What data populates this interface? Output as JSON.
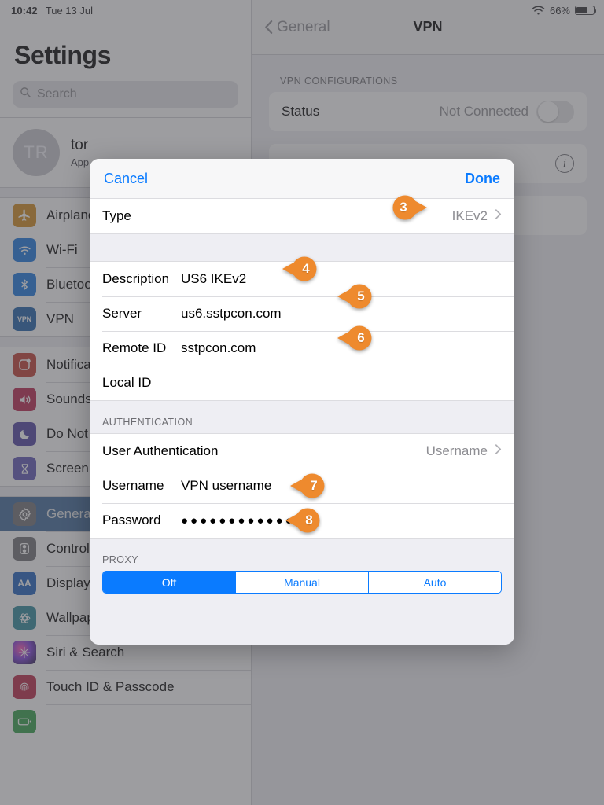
{
  "statusbar": {
    "time": "10:42",
    "date": "Tue 13 Jul",
    "wifi_icon": "wifi-icon",
    "battery_percent": "66%",
    "battery_level": 66
  },
  "sidebar": {
    "title": "Settings",
    "search": {
      "placeholder": "Search",
      "icon": "search-icon"
    },
    "account": {
      "initials": "TR",
      "name": "tor",
      "subtitle": "App"
    },
    "groups": [
      {
        "items": [
          {
            "label": "Airplane Mode",
            "icon": "airplane-icon",
            "color": "#d2891a",
            "glyph": "✈"
          },
          {
            "label": "Wi-Fi",
            "icon": "wifi-icon",
            "color": "#1574e0",
            "glyph": "📶"
          },
          {
            "label": "Bluetooth",
            "icon": "bluetooth-icon",
            "color": "#1574e0",
            "glyph": "ᛗ"
          },
          {
            "label": "VPN",
            "icon": "vpn-icon",
            "color": "#1b5fa8",
            "glyph": "VPN"
          }
        ]
      },
      {
        "items": [
          {
            "label": "Notifications",
            "icon": "notifications-icon",
            "color": "#c0392f",
            "glyph": "▢"
          },
          {
            "label": "Sounds",
            "icon": "sounds-icon",
            "color": "#b9214a",
            "glyph": "🔊"
          },
          {
            "label": "Do Not Disturb",
            "icon": "moon-icon",
            "color": "#4b3fa0",
            "glyph": "☾"
          },
          {
            "label": "Screen Time",
            "icon": "hourglass-icon",
            "color": "#5b53b5",
            "glyph": "⌛"
          }
        ]
      },
      {
        "items": [
          {
            "label": "General",
            "icon": "gear-icon",
            "color": "#6e6e73",
            "glyph": "⚙",
            "selected": true
          },
          {
            "label": "Control Center",
            "icon": "control-center-icon",
            "color": "#6e6e73",
            "glyph": "⊙"
          },
          {
            "label": "Display & Brightness",
            "icon": "display-brightness-icon",
            "color": "#1a5fbd",
            "glyph": "AA"
          },
          {
            "label": "Wallpaper",
            "icon": "wallpaper-icon",
            "color": "#2b8699",
            "glyph": "✻"
          },
          {
            "label": "Siri & Search",
            "icon": "siri-icon",
            "color": "#2a1f4e",
            "glyph": "✦"
          },
          {
            "label": "Touch ID & Passcode",
            "icon": "touch-id-icon",
            "color": "#b92343",
            "glyph": "◉"
          },
          {
            "label": "",
            "icon": "battery-icon",
            "color": "#2f9e44",
            "glyph": ""
          }
        ]
      }
    ]
  },
  "detail": {
    "nav": {
      "back_label": "General",
      "back_icon": "chevron-left-icon",
      "title": "VPN"
    },
    "section_header": "VPN CONFIGURATIONS",
    "status_row": {
      "label": "Status",
      "value": "Not Connected",
      "toggle_on": false
    },
    "info_row": {
      "icon": "info-icon"
    }
  },
  "modal": {
    "cancel_label": "Cancel",
    "done_label": "Done",
    "type_row": {
      "label": "Type",
      "value": "IKEv2",
      "chevron": "chevron-right-icon"
    },
    "config_rows": [
      {
        "label": "Description",
        "value": "US6 IKEv2"
      },
      {
        "label": "Server",
        "value": "us6.sstpcon.com"
      },
      {
        "label": "Remote ID",
        "value": "sstpcon.com"
      },
      {
        "label": "Local ID",
        "value": ""
      }
    ],
    "auth_header": "AUTHENTICATION",
    "auth_rows": [
      {
        "label": "User Authentication",
        "value": "Username",
        "chevron": true
      },
      {
        "label": "Username",
        "value": "VPN username"
      },
      {
        "label": "Password",
        "value": "●●●●●●●●●●●●"
      }
    ],
    "proxy_header": "PROXY",
    "proxy_options": [
      {
        "label": "Off",
        "active": true
      },
      {
        "label": "Manual",
        "active": false
      },
      {
        "label": "Auto",
        "active": false
      }
    ]
  },
  "callouts": [
    {
      "number": "3",
      "direction": "right"
    },
    {
      "number": "4",
      "direction": "left"
    },
    {
      "number": "5",
      "direction": "left"
    },
    {
      "number": "6",
      "direction": "left"
    },
    {
      "number": "7",
      "direction": "left"
    },
    {
      "number": "8",
      "direction": "left"
    }
  ],
  "colors": {
    "accent_blue": "#0a7bff",
    "callout_orange": "#ee8a2e",
    "selected_row": "#3b6698"
  }
}
